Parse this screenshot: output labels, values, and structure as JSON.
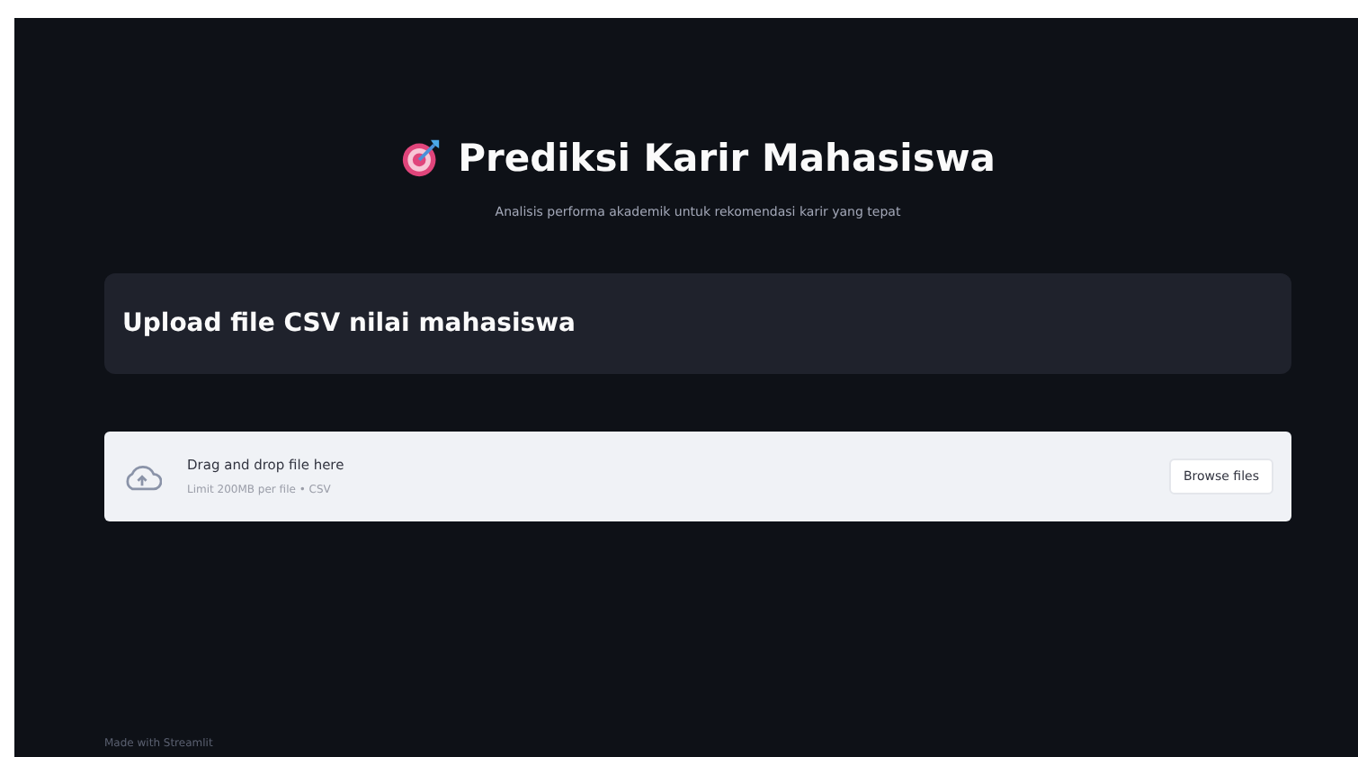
{
  "header": {
    "title": "Prediksi Karir Mahasiswa",
    "subtitle": "Analisis performa akademik untuk rekomendasi karir yang tepat"
  },
  "section": {
    "title": "Upload file CSV nilai mahasiswa"
  },
  "uploader": {
    "instruction": "Drag and drop file here",
    "limit": "Limit 200MB per file • CSV",
    "button": "Browse files"
  },
  "footer": {
    "text": "Made with Streamlit"
  }
}
